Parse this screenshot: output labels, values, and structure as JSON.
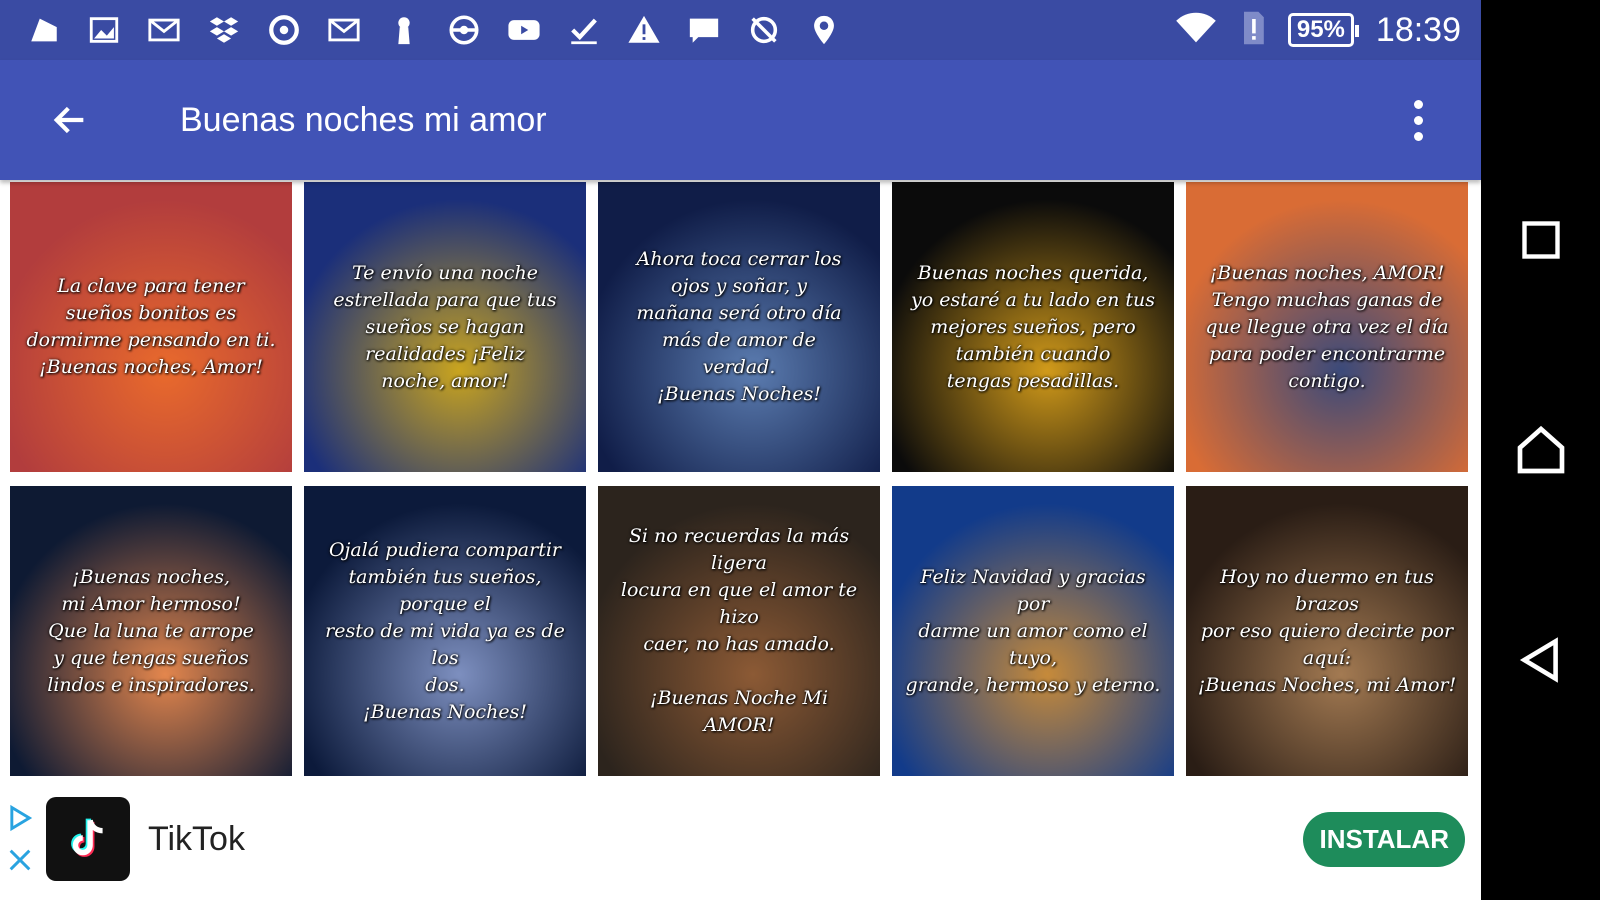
{
  "status_bar": {
    "icons": [
      "file-icon",
      "image-icon",
      "gmail-icon",
      "dropbox-icon",
      "sync-icon",
      "gmail-icon",
      "keyhole-icon",
      "pokeball-icon",
      "youtube-icon",
      "checkbox-icon",
      "warning-icon",
      "chat-icon",
      "no-location-icon",
      "location-pin-icon"
    ],
    "battery": "95%",
    "time": "18:39"
  },
  "app_bar": {
    "title": "Buenas noches mi amor"
  },
  "cards": [
    {
      "text": "La clave para tener\nsueños bonitos es\ndormirme pensando en ti.\n¡Buenas noches, Amor!",
      "bg": "#b23d3d",
      "bg2": "#e96a2c"
    },
    {
      "text": "Te envío una noche\nestrellada para que tus\nsueños se hagan\nrealidades ¡Feliz\nnoche, amor!",
      "bg": "#1b2f7a",
      "bg2": "#c9a41f"
    },
    {
      "text": "Ahora toca cerrar los\nojos y soñar, y\nmañana será otro día\nmás de amor de\nverdad.\n¡Buenas Noches!",
      "bg": "#101d48",
      "bg2": "#5b7cb0"
    },
    {
      "text": "Buenas noches querida,\nyo estaré a tu lado en tus\nmejores sueños, pero\ntambién cuando\ntengas pesadillas.",
      "bg": "#0b0b0b",
      "bg2": "#d19a1a"
    },
    {
      "text": "¡Buenas noches, AMOR!\nTengo muchas ganas de\nque llegue otra vez el día\npara poder encontrarme\ncontigo.",
      "bg": "#d96c35",
      "bg2": "#3b4a7a"
    },
    {
      "text": "¡Buenas noches,\nmi Amor hermoso!\nQue la luna te arrope\ny que tengas sueños\nlindos e inspiradores.",
      "bg": "#0e1a33",
      "bg2": "#e3864d"
    },
    {
      "text": "Ojalá pudiera compartir\ntambién tus sueños, porque el\nresto de mi vida ya es de los\ndos.\n¡Buenas Noches!",
      "bg": "#0c1a3b",
      "bg2": "#7d8fbf"
    },
    {
      "text": "Si no recuerdas la más ligera\nlocura en que el amor te hizo\ncaer, no has amado.\n\n¡Buenas Noche Mi\nAMOR!",
      "bg": "#2c241d",
      "bg2": "#8c5a35"
    },
    {
      "text": "Feliz Navidad y gracias por\ndarme un amor como el tuyo,\ngrande, hermoso y eterno.",
      "bg": "#123b8a",
      "bg2": "#c68a3a"
    },
    {
      "text": "Hoy no duermo en tus brazos\npor eso quiero decirte por aquí:\n¡Buenas Noches, mi Amor!",
      "bg": "#2a1d15",
      "bg2": "#a37a52"
    }
  ],
  "ad": {
    "name": "TikTok",
    "install_label": "INSTALAR"
  },
  "nav": {
    "buttons": [
      "recents-icon",
      "home-icon",
      "back-icon"
    ]
  }
}
